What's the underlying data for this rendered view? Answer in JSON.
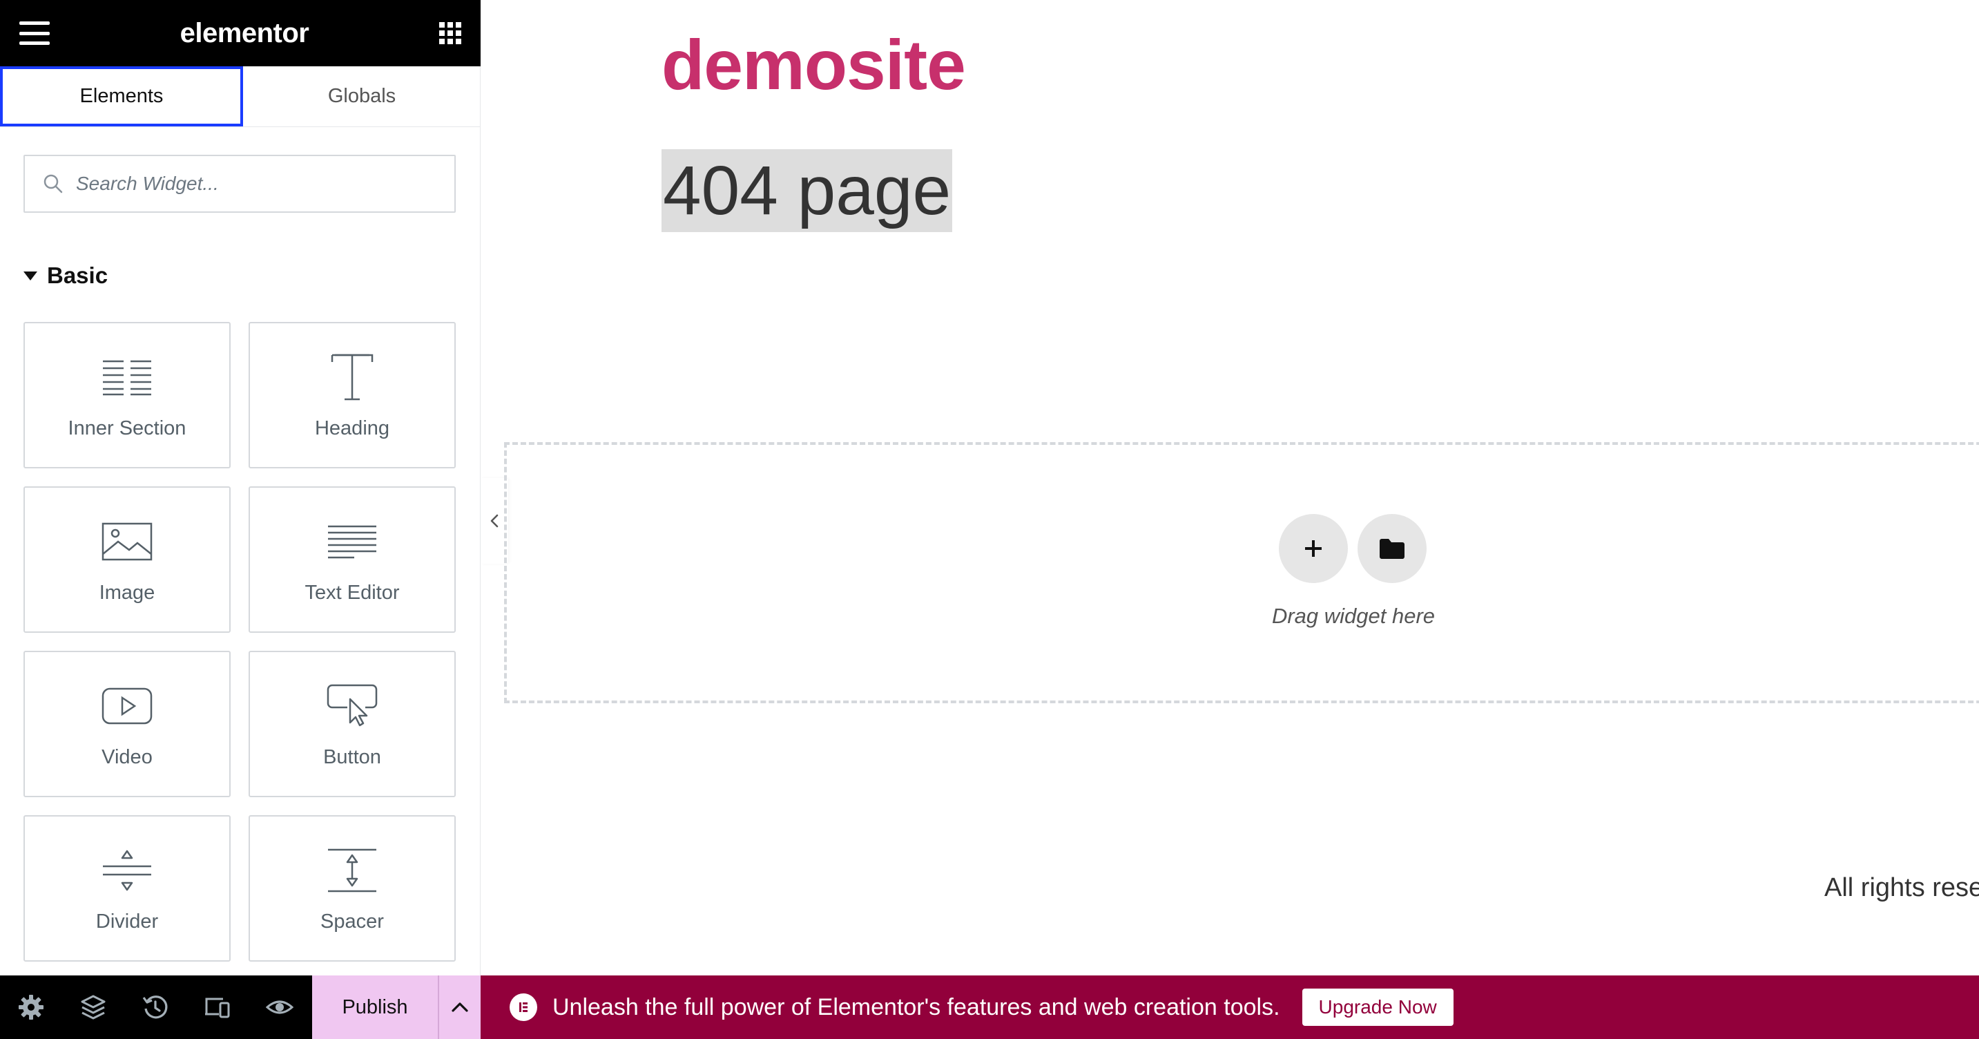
{
  "panel": {
    "logo": "elementor",
    "tabs": [
      {
        "label": "Elements",
        "active": true
      },
      {
        "label": "Globals",
        "active": false
      }
    ],
    "search": {
      "placeholder": "Search Widget...",
      "value": ""
    },
    "category": "Basic",
    "widgets": [
      {
        "label": "Inner Section",
        "icon": "inner-section-icon"
      },
      {
        "label": "Heading",
        "icon": "heading-icon"
      },
      {
        "label": "Image",
        "icon": "image-icon"
      },
      {
        "label": "Text Editor",
        "icon": "text-editor-icon"
      },
      {
        "label": "Video",
        "icon": "video-icon"
      },
      {
        "label": "Button",
        "icon": "button-icon"
      },
      {
        "label": "Divider",
        "icon": "divider-icon"
      },
      {
        "label": "Spacer",
        "icon": "spacer-icon"
      }
    ]
  },
  "footer": {
    "icons": [
      "settings-icon",
      "navigator-icon",
      "history-icon",
      "responsive-icon",
      "preview-icon"
    ],
    "publish_label": "Publish"
  },
  "promo": {
    "text": "Unleash the full power of Elementor's features and web creation tools.",
    "button_label": "Upgrade Now",
    "color": "#92003b"
  },
  "canvas": {
    "site_title": "demosite",
    "page_title": "404 page",
    "dropzone_label": "Drag widget here",
    "footer_text": "All rights rese"
  },
  "colors": {
    "site_title": "#c7306c",
    "active_tab_outline": "#1a3cff",
    "publish_bg": "#f0c7f1"
  }
}
